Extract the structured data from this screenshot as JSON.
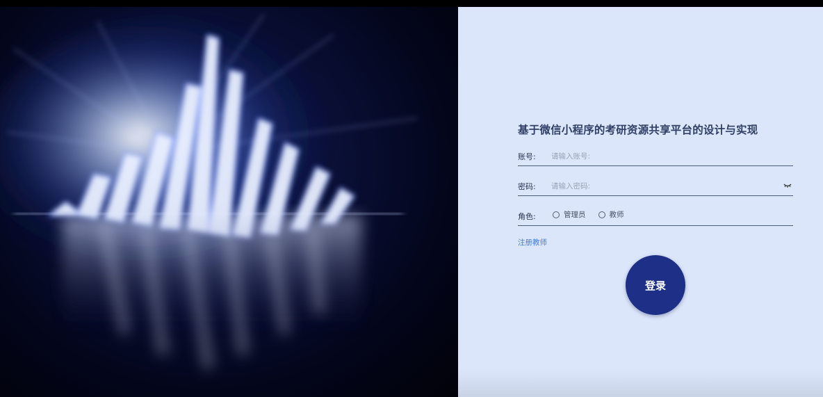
{
  "app": {
    "title": "基于微信小程序的考研资源共享平台的设计与实现"
  },
  "form": {
    "account_label": "账号:",
    "account_placeholder": "请输入账号:",
    "password_label": "密码:",
    "password_placeholder": "请输入密码:",
    "role_label": "角色:",
    "roles": [
      "管理员",
      "教师"
    ],
    "register_link": "注册教师",
    "login_button": "登录"
  },
  "icons": {
    "password_toggle": "eye-closed-icon",
    "background_art": "light-sculpture-image"
  },
  "colors": {
    "panel_bg": "#dce6fb",
    "primary_button": "#1d2f86",
    "link": "#3d7fe0",
    "title_text": "#2f3f66"
  }
}
